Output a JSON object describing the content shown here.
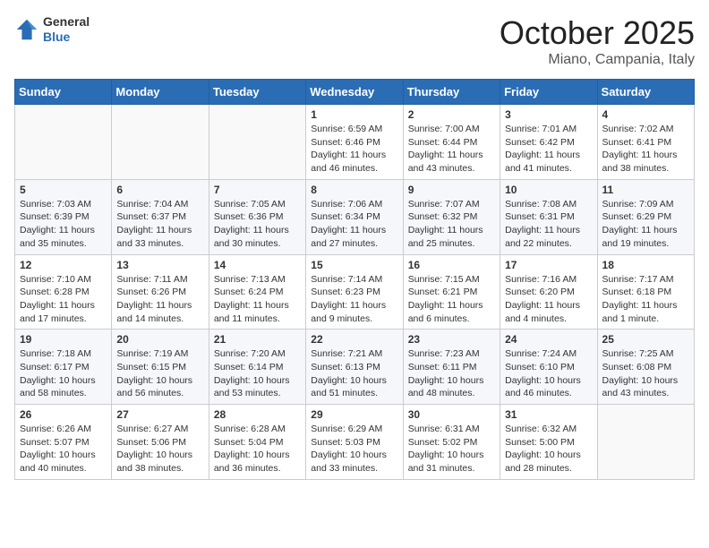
{
  "header": {
    "logo_general": "General",
    "logo_blue": "Blue",
    "month": "October 2025",
    "location": "Miano, Campania, Italy"
  },
  "weekdays": [
    "Sunday",
    "Monday",
    "Tuesday",
    "Wednesday",
    "Thursday",
    "Friday",
    "Saturday"
  ],
  "weeks": [
    [
      {
        "day": "",
        "info": ""
      },
      {
        "day": "",
        "info": ""
      },
      {
        "day": "",
        "info": ""
      },
      {
        "day": "1",
        "info": "Sunrise: 6:59 AM\nSunset: 6:46 PM\nDaylight: 11 hours and 46 minutes."
      },
      {
        "day": "2",
        "info": "Sunrise: 7:00 AM\nSunset: 6:44 PM\nDaylight: 11 hours and 43 minutes."
      },
      {
        "day": "3",
        "info": "Sunrise: 7:01 AM\nSunset: 6:42 PM\nDaylight: 11 hours and 41 minutes."
      },
      {
        "day": "4",
        "info": "Sunrise: 7:02 AM\nSunset: 6:41 PM\nDaylight: 11 hours and 38 minutes."
      }
    ],
    [
      {
        "day": "5",
        "info": "Sunrise: 7:03 AM\nSunset: 6:39 PM\nDaylight: 11 hours and 35 minutes."
      },
      {
        "day": "6",
        "info": "Sunrise: 7:04 AM\nSunset: 6:37 PM\nDaylight: 11 hours and 33 minutes."
      },
      {
        "day": "7",
        "info": "Sunrise: 7:05 AM\nSunset: 6:36 PM\nDaylight: 11 hours and 30 minutes."
      },
      {
        "day": "8",
        "info": "Sunrise: 7:06 AM\nSunset: 6:34 PM\nDaylight: 11 hours and 27 minutes."
      },
      {
        "day": "9",
        "info": "Sunrise: 7:07 AM\nSunset: 6:32 PM\nDaylight: 11 hours and 25 minutes."
      },
      {
        "day": "10",
        "info": "Sunrise: 7:08 AM\nSunset: 6:31 PM\nDaylight: 11 hours and 22 minutes."
      },
      {
        "day": "11",
        "info": "Sunrise: 7:09 AM\nSunset: 6:29 PM\nDaylight: 11 hours and 19 minutes."
      }
    ],
    [
      {
        "day": "12",
        "info": "Sunrise: 7:10 AM\nSunset: 6:28 PM\nDaylight: 11 hours and 17 minutes."
      },
      {
        "day": "13",
        "info": "Sunrise: 7:11 AM\nSunset: 6:26 PM\nDaylight: 11 hours and 14 minutes."
      },
      {
        "day": "14",
        "info": "Sunrise: 7:13 AM\nSunset: 6:24 PM\nDaylight: 11 hours and 11 minutes."
      },
      {
        "day": "15",
        "info": "Sunrise: 7:14 AM\nSunset: 6:23 PM\nDaylight: 11 hours and 9 minutes."
      },
      {
        "day": "16",
        "info": "Sunrise: 7:15 AM\nSunset: 6:21 PM\nDaylight: 11 hours and 6 minutes."
      },
      {
        "day": "17",
        "info": "Sunrise: 7:16 AM\nSunset: 6:20 PM\nDaylight: 11 hours and 4 minutes."
      },
      {
        "day": "18",
        "info": "Sunrise: 7:17 AM\nSunset: 6:18 PM\nDaylight: 11 hours and 1 minute."
      }
    ],
    [
      {
        "day": "19",
        "info": "Sunrise: 7:18 AM\nSunset: 6:17 PM\nDaylight: 10 hours and 58 minutes."
      },
      {
        "day": "20",
        "info": "Sunrise: 7:19 AM\nSunset: 6:15 PM\nDaylight: 10 hours and 56 minutes."
      },
      {
        "day": "21",
        "info": "Sunrise: 7:20 AM\nSunset: 6:14 PM\nDaylight: 10 hours and 53 minutes."
      },
      {
        "day": "22",
        "info": "Sunrise: 7:21 AM\nSunset: 6:13 PM\nDaylight: 10 hours and 51 minutes."
      },
      {
        "day": "23",
        "info": "Sunrise: 7:23 AM\nSunset: 6:11 PM\nDaylight: 10 hours and 48 minutes."
      },
      {
        "day": "24",
        "info": "Sunrise: 7:24 AM\nSunset: 6:10 PM\nDaylight: 10 hours and 46 minutes."
      },
      {
        "day": "25",
        "info": "Sunrise: 7:25 AM\nSunset: 6:08 PM\nDaylight: 10 hours and 43 minutes."
      }
    ],
    [
      {
        "day": "26",
        "info": "Sunrise: 6:26 AM\nSunset: 5:07 PM\nDaylight: 10 hours and 40 minutes."
      },
      {
        "day": "27",
        "info": "Sunrise: 6:27 AM\nSunset: 5:06 PM\nDaylight: 10 hours and 38 minutes."
      },
      {
        "day": "28",
        "info": "Sunrise: 6:28 AM\nSunset: 5:04 PM\nDaylight: 10 hours and 36 minutes."
      },
      {
        "day": "29",
        "info": "Sunrise: 6:29 AM\nSunset: 5:03 PM\nDaylight: 10 hours and 33 minutes."
      },
      {
        "day": "30",
        "info": "Sunrise: 6:31 AM\nSunset: 5:02 PM\nDaylight: 10 hours and 31 minutes."
      },
      {
        "day": "31",
        "info": "Sunrise: 6:32 AM\nSunset: 5:00 PM\nDaylight: 10 hours and 28 minutes."
      },
      {
        "day": "",
        "info": ""
      }
    ]
  ]
}
